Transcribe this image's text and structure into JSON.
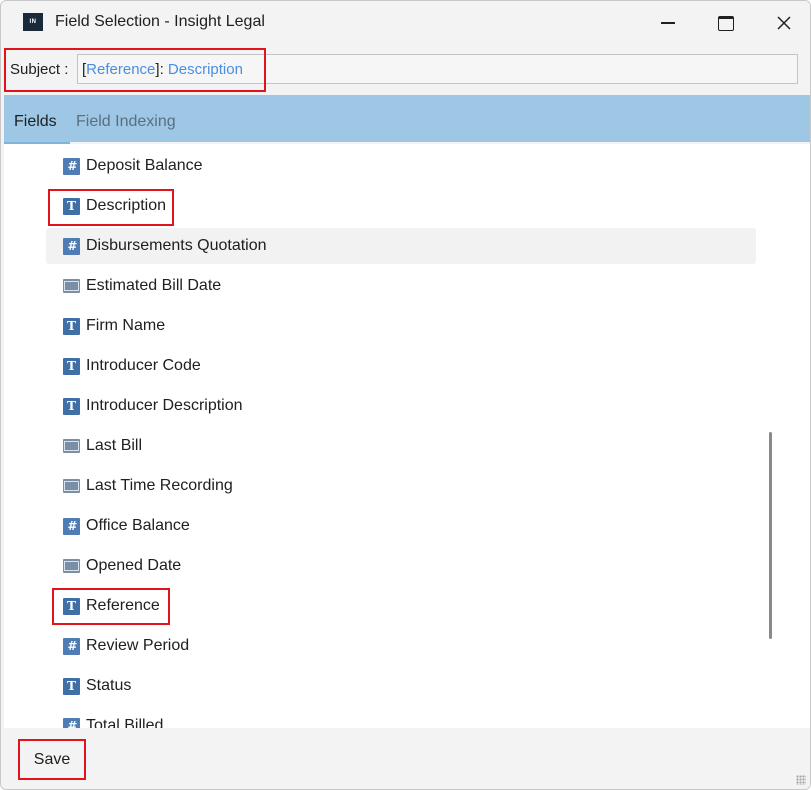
{
  "window": {
    "title": "Field Selection - Insight Legal",
    "logo_text": "IN",
    "controls": {
      "minimize": "minimize-icon",
      "maximize": "maximize-icon",
      "close": "close-icon"
    }
  },
  "subject": {
    "label": "Subject :",
    "open1": "[",
    "token1": "Reference",
    "close1": "]",
    "sep": ": ",
    "token2": "Description"
  },
  "tabs": [
    {
      "label": "Fields",
      "active": true
    },
    {
      "label": "Field Indexing",
      "active": false
    }
  ],
  "fields": [
    {
      "label": "Deposit Balance",
      "icon": "number-field-icon",
      "glyph": "#"
    },
    {
      "label": "Description",
      "icon": "text-field-icon",
      "glyph": "T"
    },
    {
      "label": "Disbursements Quotation",
      "icon": "number-field-icon",
      "glyph": "#"
    },
    {
      "label": "Estimated Bill Date",
      "icon": "date-field-icon",
      "glyph": ""
    },
    {
      "label": "Firm Name",
      "icon": "text-field-icon",
      "glyph": "T"
    },
    {
      "label": "Introducer Code",
      "icon": "text-field-icon",
      "glyph": "T"
    },
    {
      "label": "Introducer Description",
      "icon": "text-field-icon",
      "glyph": "T"
    },
    {
      "label": "Last Bill",
      "icon": "date-field-icon",
      "glyph": ""
    },
    {
      "label": "Last Time Recording",
      "icon": "date-field-icon",
      "glyph": ""
    },
    {
      "label": "Office Balance",
      "icon": "number-field-icon",
      "glyph": "#"
    },
    {
      "label": "Opened Date",
      "icon": "date-field-icon",
      "glyph": ""
    },
    {
      "label": "Reference",
      "icon": "text-field-icon",
      "glyph": "T"
    },
    {
      "label": "Review Period",
      "icon": "number-field-icon",
      "glyph": "#"
    },
    {
      "label": "Status",
      "icon": "text-field-icon",
      "glyph": "T"
    },
    {
      "label": "Total Billed",
      "icon": "number-field-icon",
      "glyph": "#"
    }
  ],
  "footer": {
    "save_label": "Save"
  },
  "colors": {
    "tabbar": "#9ec7e5",
    "highlight": "#e0141b",
    "token": "#4a8ee0"
  }
}
